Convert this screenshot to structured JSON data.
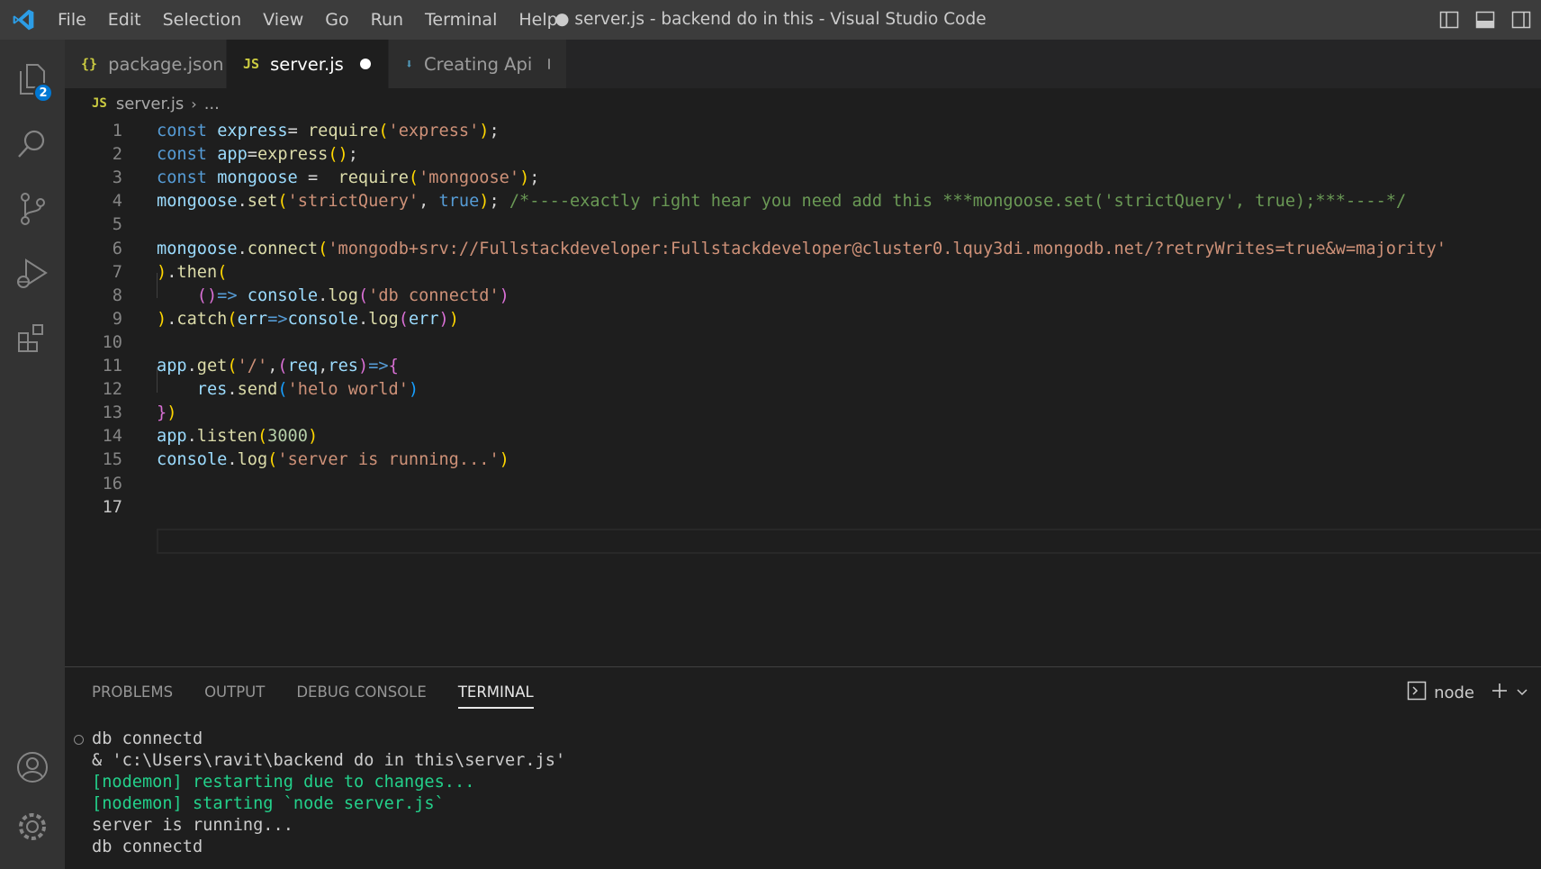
{
  "titlebar": {
    "menu": [
      "File",
      "Edit",
      "Selection",
      "View",
      "Go",
      "Run",
      "Terminal",
      "Help"
    ],
    "title": "● server.js - backend do in this - Visual Studio Code"
  },
  "activity": {
    "explorer_badge": "2"
  },
  "tabs": [
    {
      "icon": "{}",
      "label": "package.json",
      "icon_color": "#cbcb41"
    },
    {
      "icon": "JS",
      "label": "server.js",
      "icon_color": "#cbcb41"
    },
    {
      "icon": "⬇",
      "label": "Creating Api",
      "icon_color": "#519aba"
    }
  ],
  "breadcrumb": {
    "icon": "JS",
    "file": "server.js",
    "more": "..."
  },
  "editor": {
    "line_numbers": [
      "1",
      "2",
      "3",
      "4",
      "5",
      "6",
      "7",
      "8",
      "9",
      "10",
      "11",
      "12",
      "13",
      "14",
      "15",
      "16",
      "17"
    ],
    "current_line": 17,
    "lines": [
      [
        [
          "kw",
          "const"
        ],
        [
          "p",
          " "
        ],
        [
          "var",
          "express"
        ],
        [
          "p",
          "= "
        ],
        [
          "fn",
          "require"
        ],
        [
          "b1",
          "("
        ],
        [
          "str",
          "'express'"
        ],
        [
          "b1",
          ")"
        ],
        [
          "p",
          ";"
        ]
      ],
      [
        [
          "kw",
          "const"
        ],
        [
          "p",
          " "
        ],
        [
          "var",
          "app"
        ],
        [
          "p",
          "="
        ],
        [
          "fn",
          "express"
        ],
        [
          "b1",
          "()"
        ],
        [
          "p",
          ";"
        ]
      ],
      [
        [
          "kw",
          "const"
        ],
        [
          "p",
          " "
        ],
        [
          "var",
          "mongoose"
        ],
        [
          "p",
          " =  "
        ],
        [
          "fn",
          "require"
        ],
        [
          "b1",
          "("
        ],
        [
          "str",
          "'mongoose'"
        ],
        [
          "b1",
          ")"
        ],
        [
          "p",
          ";"
        ]
      ],
      [
        [
          "var",
          "mongoose"
        ],
        [
          "p",
          "."
        ],
        [
          "fn",
          "set"
        ],
        [
          "b1",
          "("
        ],
        [
          "str",
          "'strictQuery'"
        ],
        [
          "p",
          ", "
        ],
        [
          "kw",
          "true"
        ],
        [
          "b1",
          ")"
        ],
        [
          "p",
          "; "
        ],
        [
          "cm",
          "/*----exactly right hear you need add this ***mongoose.set('strictQuery', true);***----*/"
        ]
      ],
      [],
      [
        [
          "var",
          "mongoose"
        ],
        [
          "p",
          "."
        ],
        [
          "fn",
          "connect"
        ],
        [
          "b1",
          "("
        ],
        [
          "str",
          "'mongodb+srv://Fullstackdeveloper:Fullstackdeveloper@cluster0.lquy3di.mongodb.net/?retryWrites=true&w=majority'"
        ]
      ],
      [
        [
          "b1",
          ")"
        ],
        [
          "p",
          "."
        ],
        [
          "fn",
          "then"
        ],
        [
          "b1",
          "("
        ]
      ],
      [
        [
          "p",
          "    "
        ],
        [
          "b2",
          "()"
        ],
        [
          "kw",
          "=>"
        ],
        [
          "p",
          " "
        ],
        [
          "var",
          "console"
        ],
        [
          "p",
          "."
        ],
        [
          "fn",
          "log"
        ],
        [
          "b2",
          "("
        ],
        [
          "str",
          "'db connectd'"
        ],
        [
          "b2",
          ")"
        ]
      ],
      [
        [
          "b1",
          ")"
        ],
        [
          "p",
          "."
        ],
        [
          "fn",
          "catch"
        ],
        [
          "b1",
          "("
        ],
        [
          "var",
          "err"
        ],
        [
          "kw",
          "=>"
        ],
        [
          "var",
          "console"
        ],
        [
          "p",
          "."
        ],
        [
          "fn",
          "log"
        ],
        [
          "b2",
          "("
        ],
        [
          "var",
          "err"
        ],
        [
          "b2",
          ")"
        ],
        [
          "b1",
          ")"
        ]
      ],
      [],
      [
        [
          "var",
          "app"
        ],
        [
          "p",
          "."
        ],
        [
          "fn",
          "get"
        ],
        [
          "b1",
          "("
        ],
        [
          "str",
          "'/'"
        ],
        [
          "p",
          ","
        ],
        [
          "b2",
          "("
        ],
        [
          "var",
          "req"
        ],
        [
          "p",
          ","
        ],
        [
          "var",
          "res"
        ],
        [
          "b2",
          ")"
        ],
        [
          "kw",
          "=>"
        ],
        [
          "b2",
          "{"
        ]
      ],
      [
        [
          "p",
          "    "
        ],
        [
          "var",
          "res"
        ],
        [
          "p",
          "."
        ],
        [
          "fn",
          "send"
        ],
        [
          "b3",
          "("
        ],
        [
          "str",
          "'helo world'"
        ],
        [
          "b3",
          ")"
        ]
      ],
      [
        [
          "b2",
          "}"
        ],
        [
          "b1",
          ")"
        ]
      ],
      [
        [
          "var",
          "app"
        ],
        [
          "p",
          "."
        ],
        [
          "fn",
          "listen"
        ],
        [
          "b1",
          "("
        ],
        [
          "num",
          "3000"
        ],
        [
          "b1",
          ")"
        ]
      ],
      [
        [
          "var",
          "console"
        ],
        [
          "p",
          "."
        ],
        [
          "fn",
          "log"
        ],
        [
          "b1",
          "("
        ],
        [
          "str",
          "'server is running...'"
        ],
        [
          "b1",
          ")"
        ]
      ],
      [],
      []
    ]
  },
  "panel": {
    "tabs": [
      "PROBLEMS",
      "OUTPUT",
      "DEBUG CONSOLE",
      "TERMINAL"
    ],
    "active_tab": "TERMINAL",
    "terminal_name": "node",
    "terminal_lines": [
      {
        "text": "db connectd",
        "color": "default"
      },
      {
        "text": "& 'c:\\Users\\ravit\\backend do in this\\server.js'",
        "color": "default"
      },
      {
        "text": "[nodemon] restarting due to changes...",
        "color": "green"
      },
      {
        "text": "[nodemon] starting `node server.js`",
        "color": "green"
      },
      {
        "text": "server is running...",
        "color": "default"
      },
      {
        "text": "db connectd",
        "color": "default"
      }
    ]
  }
}
